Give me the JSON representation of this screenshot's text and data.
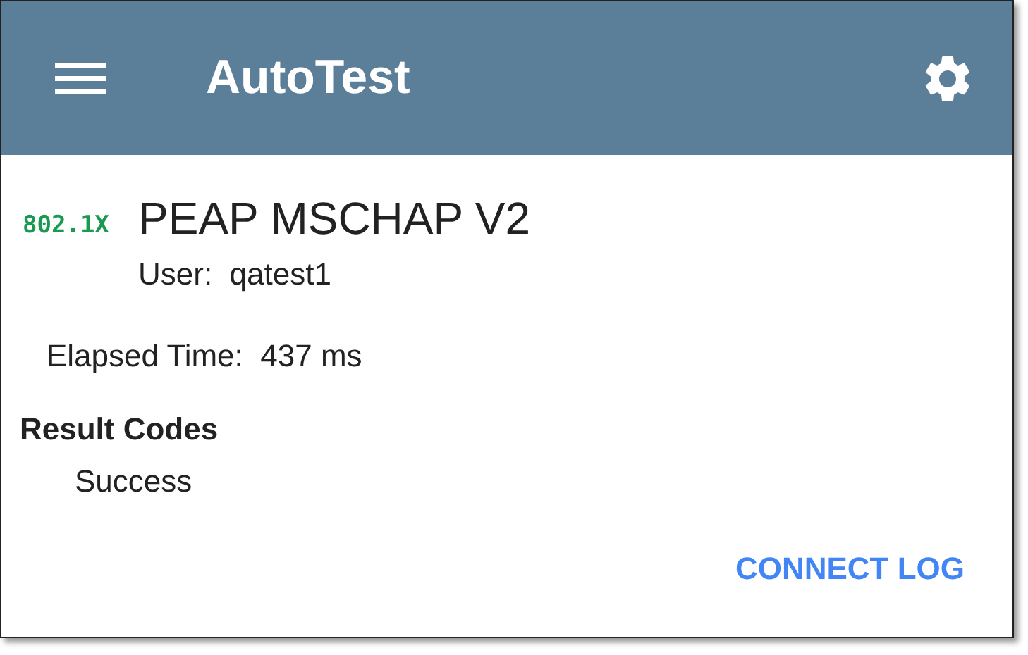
{
  "app_bar": {
    "title": "AutoTest"
  },
  "test": {
    "badge": "802.1X",
    "name": "PEAP MSCHAP V2",
    "user": "User:  qatest1"
  },
  "elapsed": "Elapsed Time:  437 ms",
  "result_codes": {
    "heading": "Result Codes",
    "items": [
      "Success"
    ]
  },
  "actions": [
    "CONNECT LOG"
  ]
}
